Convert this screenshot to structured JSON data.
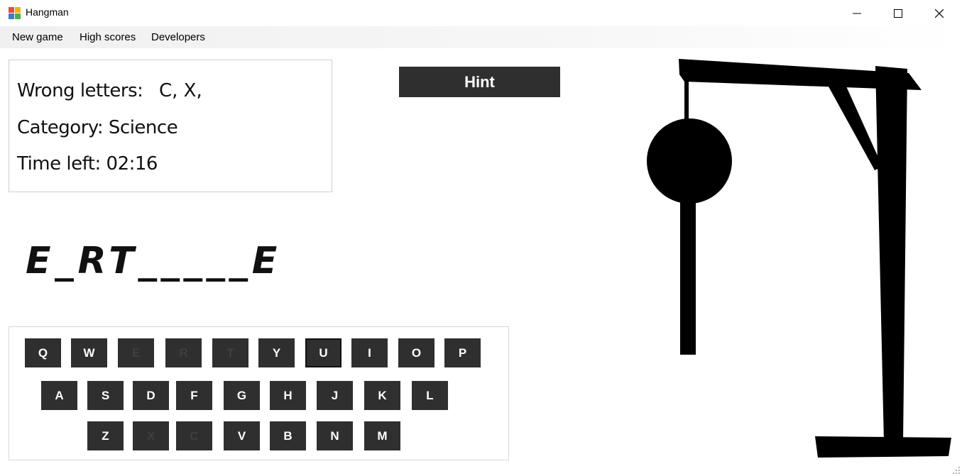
{
  "window": {
    "title": "Hangman",
    "icon": "app-window-icon",
    "controls": [
      "minimize-icon",
      "maximize-icon",
      "close-icon"
    ]
  },
  "menu": {
    "items": [
      {
        "label": "New game"
      },
      {
        "label": "High scores"
      },
      {
        "label": "Developers"
      }
    ]
  },
  "info": {
    "wrong_label": "Wrong letters:",
    "wrong_letters": "C, X,",
    "category": "Category: Science",
    "time_left": "Time left: 02:16"
  },
  "hint": {
    "label": "Hint"
  },
  "word": {
    "display": "E_RT_____E"
  },
  "keyboard": {
    "rows": [
      [
        {
          "label": "Q",
          "used": false
        },
        {
          "label": "W",
          "used": false
        },
        {
          "label": "E",
          "used": true
        },
        {
          "label": "R",
          "used": true
        },
        {
          "label": "T",
          "used": true
        },
        {
          "label": "Y",
          "used": false
        },
        {
          "label": "U",
          "used": false,
          "focused": true
        },
        {
          "label": "I",
          "used": false
        },
        {
          "label": "O",
          "used": false
        },
        {
          "label": "P",
          "used": false
        }
      ],
      [
        {
          "label": "A",
          "used": false
        },
        {
          "label": "S",
          "used": false
        },
        {
          "label": "D",
          "used": false
        },
        {
          "label": "F",
          "used": false
        },
        {
          "label": "G",
          "used": false
        },
        {
          "label": "H",
          "used": false
        },
        {
          "label": "J",
          "used": false
        },
        {
          "label": "K",
          "used": false
        },
        {
          "label": "L",
          "used": false
        }
      ],
      [
        {
          "label": "Z",
          "used": false
        },
        {
          "label": "X",
          "used": true
        },
        {
          "label": "C",
          "used": true
        },
        {
          "label": "V",
          "used": false
        },
        {
          "label": "B",
          "used": false
        },
        {
          "label": "N",
          "used": false
        },
        {
          "label": "M",
          "used": false
        }
      ]
    ]
  },
  "colors": {
    "button_bg": "#2f2f2f",
    "button_text": "#ffffff",
    "used_key_text": "#3f3f3f",
    "drawing": "#000000"
  }
}
